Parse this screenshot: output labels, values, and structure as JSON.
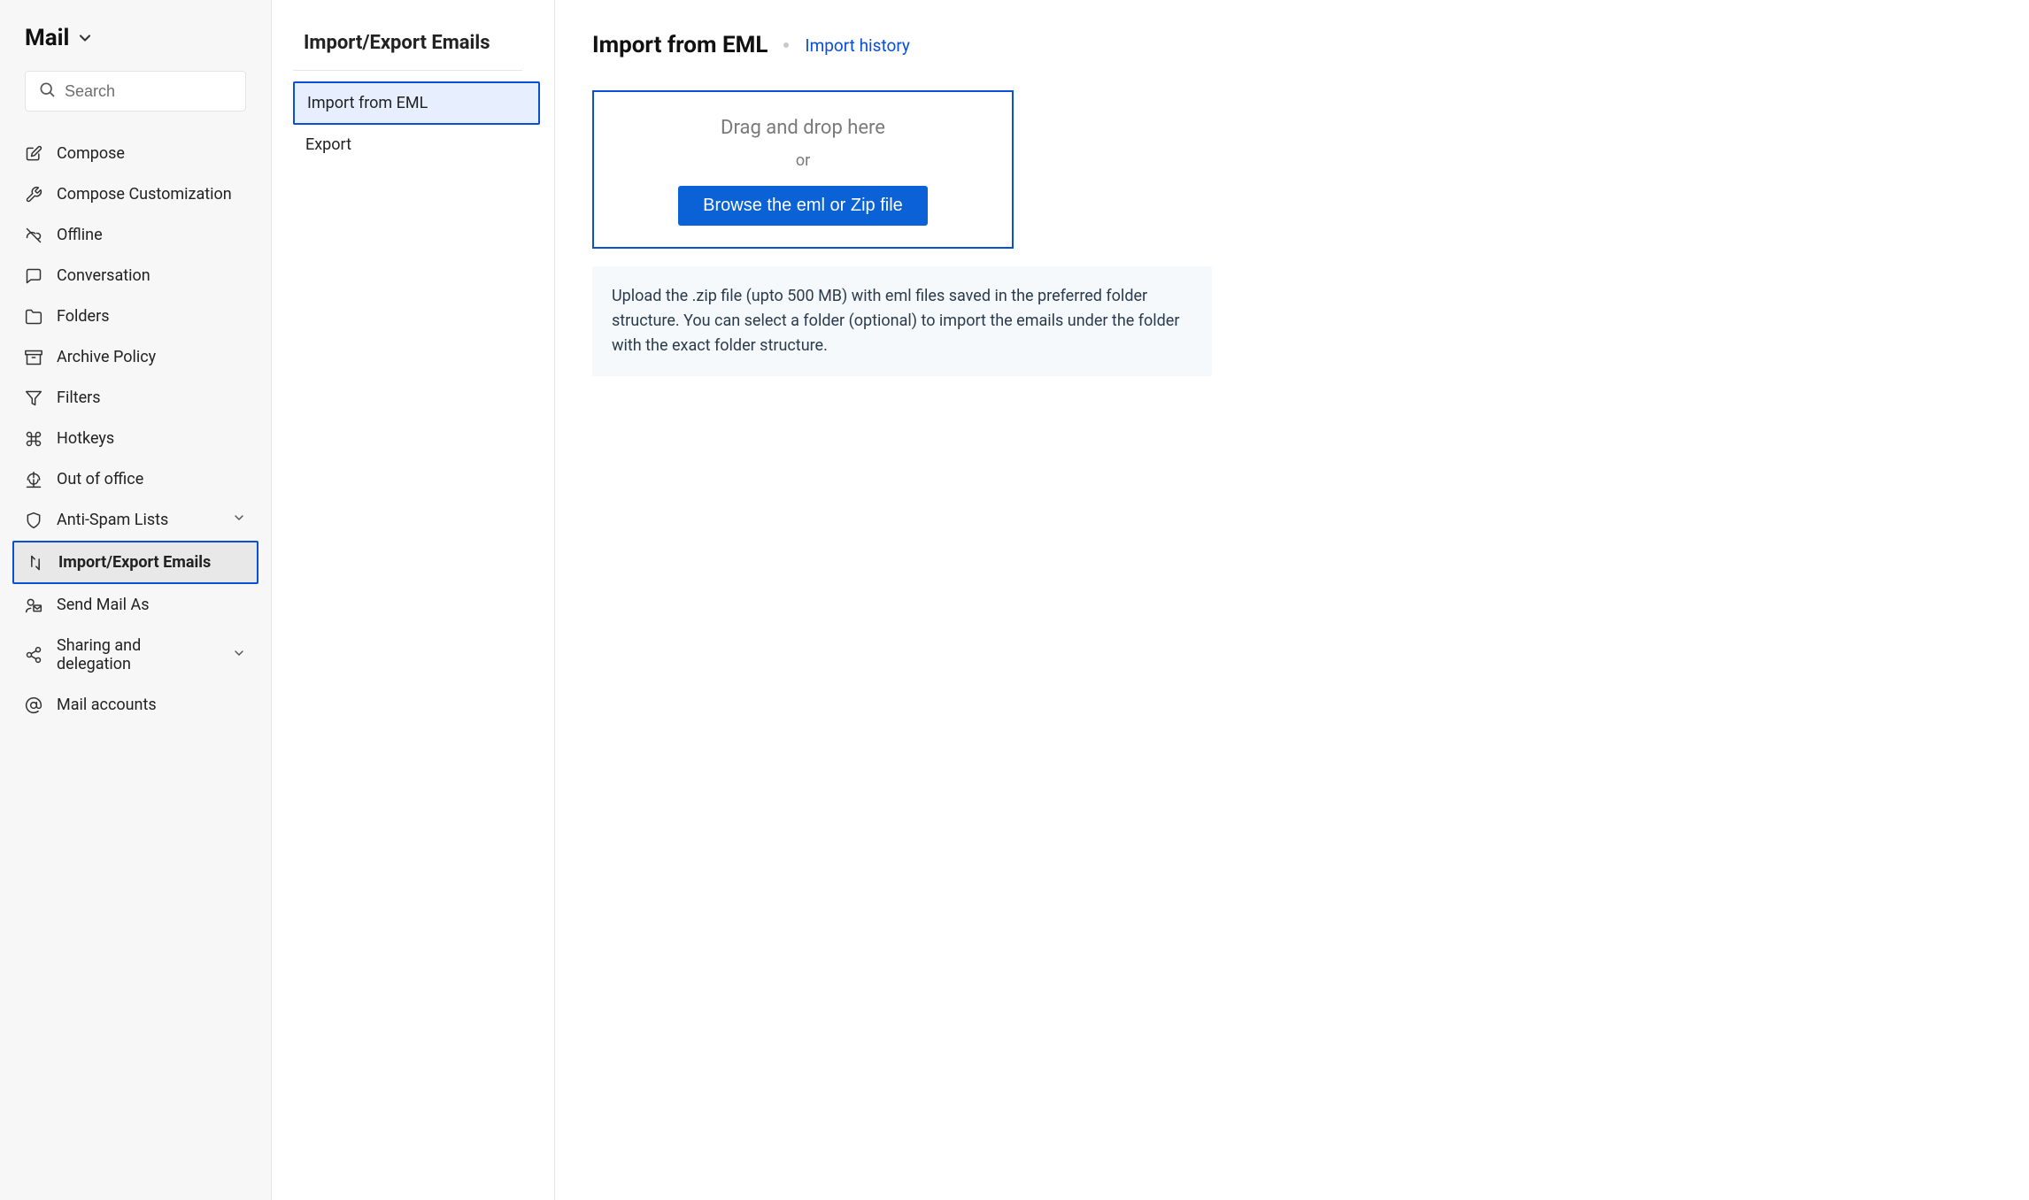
{
  "sidebar": {
    "app_label": "Mail",
    "search_placeholder": "Search",
    "items": [
      {
        "label": "Compose"
      },
      {
        "label": "Compose Customization"
      },
      {
        "label": "Offline"
      },
      {
        "label": "Conversation"
      },
      {
        "label": "Folders"
      },
      {
        "label": "Archive Policy"
      },
      {
        "label": "Filters"
      },
      {
        "label": "Hotkeys"
      },
      {
        "label": "Out of office"
      },
      {
        "label": "Anti-Spam Lists"
      },
      {
        "label": "Import/Export Emails"
      },
      {
        "label": "Send Mail As"
      },
      {
        "label": "Sharing and delegation"
      },
      {
        "label": "Mail accounts"
      }
    ]
  },
  "subpanel": {
    "title": "Import/Export Emails",
    "items": [
      {
        "label": "Import from EML"
      },
      {
        "label": "Export"
      }
    ]
  },
  "content": {
    "title": "Import from EML",
    "history_link": "Import history",
    "dropzone": {
      "hint": "Drag and drop here",
      "or": "or",
      "browse_button": "Browse the eml or Zip file"
    },
    "info_text": "Upload the .zip file (upto 500 MB) with eml files saved in the preferred folder structure. You can select a folder (optional) to import the emails under the folder with the exact folder structure."
  }
}
